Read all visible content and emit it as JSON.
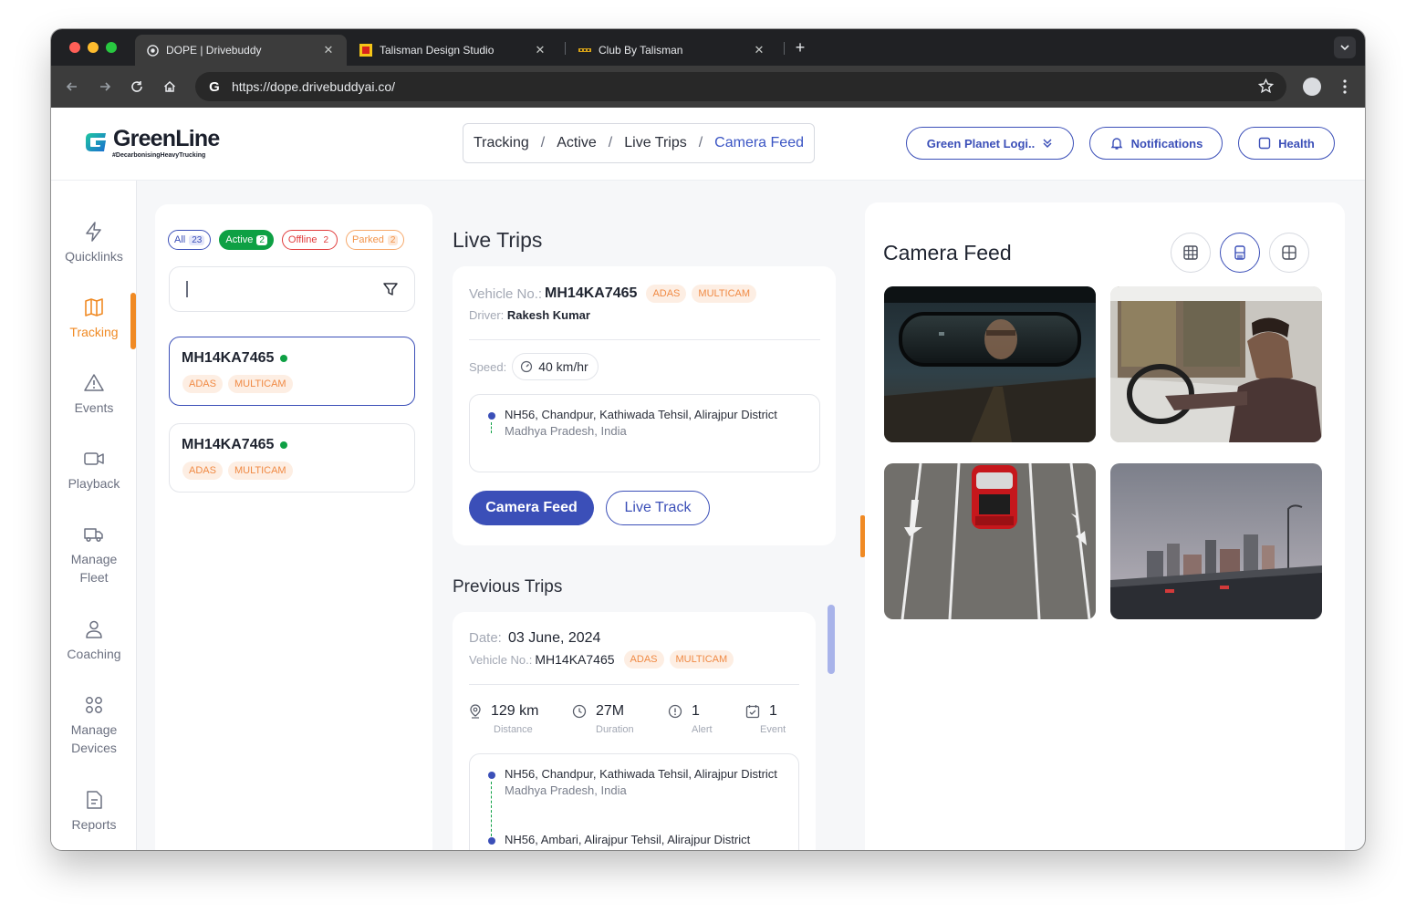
{
  "browser": {
    "tabs": [
      {
        "title": "DOPE | Drivebuddy"
      },
      {
        "title": "Talisman Design Studio"
      },
      {
        "title": "Club By Talisman"
      }
    ],
    "url": "https://dope.drivebuddyai.co/"
  },
  "header": {
    "logo_text": "GreenLine",
    "logo_tagline": "#DecarbonisingHeavyTrucking",
    "breadcrumb": [
      "Tracking",
      "Active",
      "Live Trips",
      "Camera Feed"
    ],
    "org_select": "Green Planet Logi..",
    "notifications_label": "Notifications",
    "health_label": "Health"
  },
  "sidebar": {
    "items": [
      {
        "label": "Quicklinks",
        "icon": "lightning-icon"
      },
      {
        "label": "Tracking",
        "icon": "map-icon",
        "active": true
      },
      {
        "label": "Events",
        "icon": "warning-icon"
      },
      {
        "label": "Playback",
        "icon": "video-icon"
      },
      {
        "label": "Manage Fleet",
        "icon": "truck-icon"
      },
      {
        "label": "Coaching",
        "icon": "user-icon"
      },
      {
        "label": "Manage Devices",
        "icon": "grid-icon"
      },
      {
        "label": "Reports",
        "icon": "document-icon"
      }
    ]
  },
  "filters": [
    {
      "label": "All",
      "count": "23"
    },
    {
      "label": "Active",
      "count": "2"
    },
    {
      "label": "Offline",
      "count": "2"
    },
    {
      "label": "Parked",
      "count": "2"
    }
  ],
  "search": {
    "value": ""
  },
  "vehicles": [
    {
      "number": "MH14KA7465",
      "tags": [
        "ADAS",
        "MULTICAM"
      ]
    },
    {
      "number": "MH14KA7465",
      "tags": [
        "ADAS",
        "MULTICAM"
      ]
    }
  ],
  "live_trips": {
    "title": "Live Trips",
    "vehicle_label": "Vehicle No.:",
    "vehicle_number": "MH14KA7465",
    "tags": [
      "ADAS",
      "MULTICAM"
    ],
    "driver_label": "Driver:",
    "driver_name": "Rakesh Kumar",
    "speed_label": "Speed:",
    "speed_value": "40 km/hr",
    "address_line1": "NH56, Chandpur, Kathiwada Tehsil, Alirajpur District",
    "address_line2": "Madhya Pradesh, India",
    "camera_feed_button": "Camera Feed",
    "live_track_button": "Live Track"
  },
  "previous_trips": {
    "title": "Previous Trips",
    "date_label": "Date:",
    "date": "03 June, 2024",
    "vehicle_label": "Vehicle No.:",
    "vehicle_number": "MH14KA7465",
    "tags": [
      "ADAS",
      "MULTICAM"
    ],
    "stats": [
      {
        "value": "129 km",
        "label": "Distance",
        "icon": "location-pin-icon"
      },
      {
        "value": "27M",
        "label": "Duration",
        "icon": "clock-icon"
      },
      {
        "value": "1",
        "label": "Alert",
        "icon": "alert-icon"
      },
      {
        "value": "1",
        "label": "Event",
        "icon": "calendar-check-icon"
      }
    ],
    "start_address_line1": "NH56, Chandpur, Kathiwada Tehsil, Alirajpur District",
    "start_address_line2": "Madhya Pradesh, India",
    "end_address_line1": "NH56, Ambari, Alirajpur Tehsil, Alirajpur District"
  },
  "camera_feed": {
    "title": "Camera Feed",
    "layouts": [
      "grid-3x3-icon",
      "single-column-icon",
      "grid-2x2-icon"
    ],
    "active_layout": "single-column-icon",
    "feeds": [
      "rear-view-mirror",
      "driver-cabin",
      "road-top-view",
      "city-skyline"
    ]
  },
  "colors": {
    "primary": "#3b4fb8",
    "accent": "#f08a24",
    "active_green": "#0ea044",
    "offline_red": "#e13c3c"
  }
}
